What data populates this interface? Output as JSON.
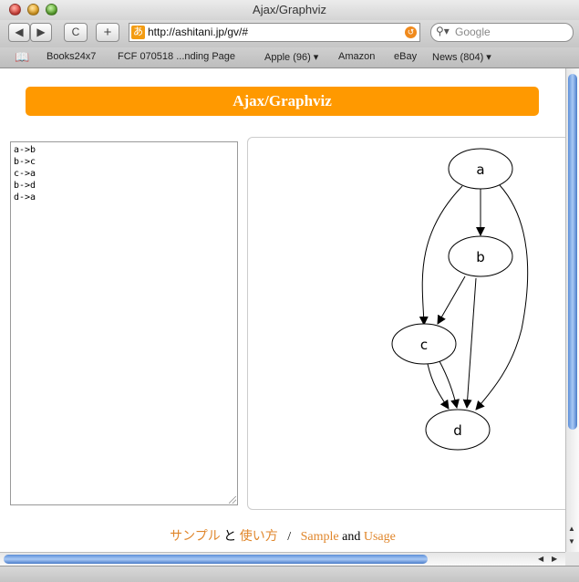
{
  "window": {
    "title": "Ajax/Graphviz"
  },
  "toolbar": {
    "back_label": "◀",
    "forward_label": "▶",
    "reload_label": "C",
    "add_label": "+",
    "favicon_glyph": "あ",
    "url": "http://ashitani.jp/gv/#",
    "search_placeholder": "Google"
  },
  "bookmarks": [
    "Books24x7",
    "FCF 070518 ...nding Page",
    "Apple (96) ▾",
    "Amazon",
    "eBay",
    "News (804) ▾"
  ],
  "page": {
    "banner": "Ajax/Graphviz",
    "source_text": "a->b\nb->c\nc->a\nb->d\nd->a",
    "graph": {
      "nodes": [
        "a",
        "b",
        "c",
        "d"
      ]
    },
    "footer": {
      "samples_ja": "サンプル",
      "and_ja": "と",
      "usage_ja": "使い方",
      "separator": "/",
      "sample_en": "Sample",
      "and_en": "and",
      "usage_en": "Usage"
    }
  }
}
